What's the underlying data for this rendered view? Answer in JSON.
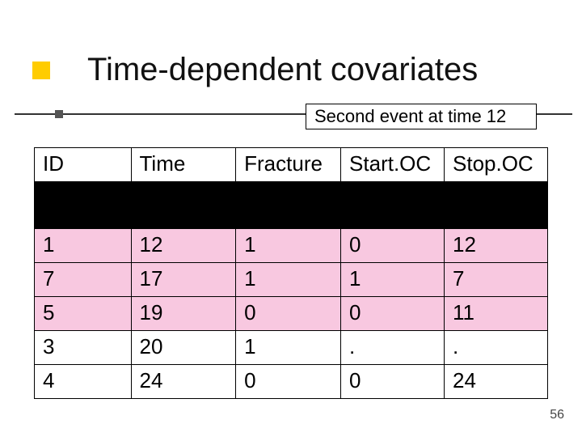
{
  "title": "Time-dependent covariates",
  "callout": "Second event at time 12",
  "headers": {
    "id": "ID",
    "time": "Time",
    "fracture": "Fracture",
    "startoc": "Start.OC",
    "stopoc": "Stop.OC"
  },
  "rows": [
    {
      "id": "1",
      "time": "12",
      "fracture": "1",
      "startoc": "0",
      "stopoc": "12",
      "highlight": true
    },
    {
      "id": "7",
      "time": "17",
      "fracture": "1",
      "startoc": "1",
      "stopoc": "7",
      "highlight": true
    },
    {
      "id": "5",
      "time": "19",
      "fracture": "0",
      "startoc": "0",
      "stopoc": "11",
      "highlight": true
    },
    {
      "id": "3",
      "time": "20",
      "fracture": "1",
      "startoc": ".",
      "stopoc": ".",
      "highlight": false
    },
    {
      "id": "4",
      "time": "24",
      "fracture": "0",
      "startoc": "0",
      "stopoc": "24",
      "highlight": false
    }
  ],
  "page_number": "56",
  "chart_data": {
    "type": "table",
    "title": "Time-dependent covariates — Second event at time 12",
    "columns": [
      "ID",
      "Time",
      "Fracture",
      "Start.OC",
      "Stop.OC"
    ],
    "rows": [
      [
        "1",
        12,
        1,
        0,
        12
      ],
      [
        "7",
        17,
        1,
        1,
        7
      ],
      [
        "5",
        19,
        0,
        0,
        11
      ],
      [
        "3",
        20,
        1,
        ".",
        "."
      ],
      [
        "4",
        24,
        0,
        0,
        24
      ]
    ],
    "highlighted_rows": [
      0,
      1,
      2
    ],
    "note": "One row between header and data is redacted (black box) in the original slide."
  }
}
